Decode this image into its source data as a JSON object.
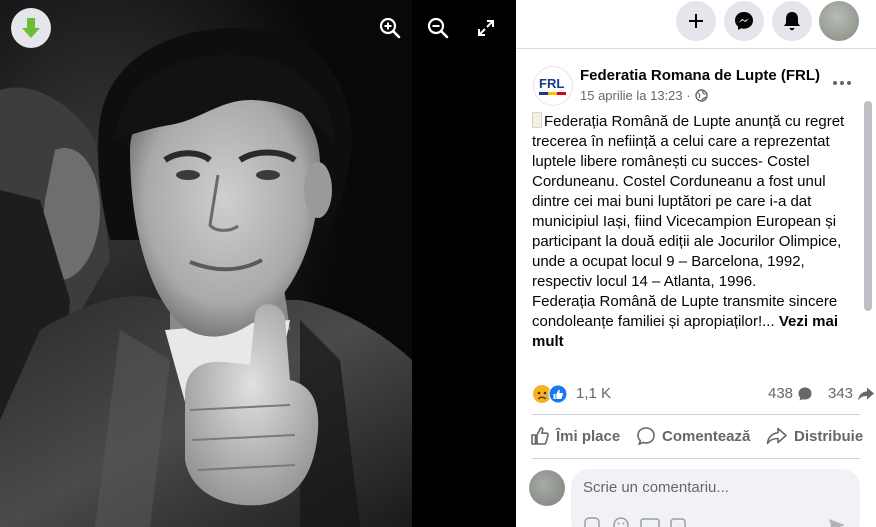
{
  "viewer": {
    "photo_alt": "Costel Corduneanu"
  },
  "post": {
    "page_name": "Federatia Romana de Lupte (FRL)",
    "logo_text": "FRL",
    "date": "15 aprilie la 13:23 ·",
    "paragraph1": "Federația Română de Lupte anunță cu regret trecerea în neființă a celui care a reprezentat luptele libere românești cu succes- Costel Corduneanu. Costel Corduneanu a fost unul dintre cei mai buni luptători pe care i-a dat municipiul Iași, fiind Vicecampion European și participant la două ediții ale Jocurilor Olimpice, unde a ocupat locul 9 – Barcelona, 1992, respectiv locul 14 – Atlanta, 1996.",
    "paragraph2": "Federația Română de Lupte transmite sincere condoleanțe familiei și apropiaților!...",
    "see_more": "Vezi mai mult",
    "reactions_count": "1,1 K",
    "comments_count": "438",
    "shares_count": "343"
  },
  "actions": {
    "like": "Îmi place",
    "comment": "Comentează",
    "share": "Distribuie"
  },
  "comment": {
    "placeholder": "Scrie un comentariu..."
  },
  "colors": {
    "accent": "#1877f2",
    "download_green": "#6bbd3a",
    "secondary_text": "#65676b",
    "icon_bg": "#e4e6eb"
  },
  "icons": [
    "download-icon",
    "zoom-in-icon",
    "zoom-out-icon",
    "fullscreen-icon",
    "plus-icon",
    "messenger-icon",
    "bell-icon",
    "globe-icon",
    "more-icon",
    "sad-reaction-icon",
    "like-reaction-icon",
    "comment-bubble-icon",
    "share-arrow-icon",
    "like-thumb-icon",
    "comment-icon",
    "share-icon"
  ]
}
